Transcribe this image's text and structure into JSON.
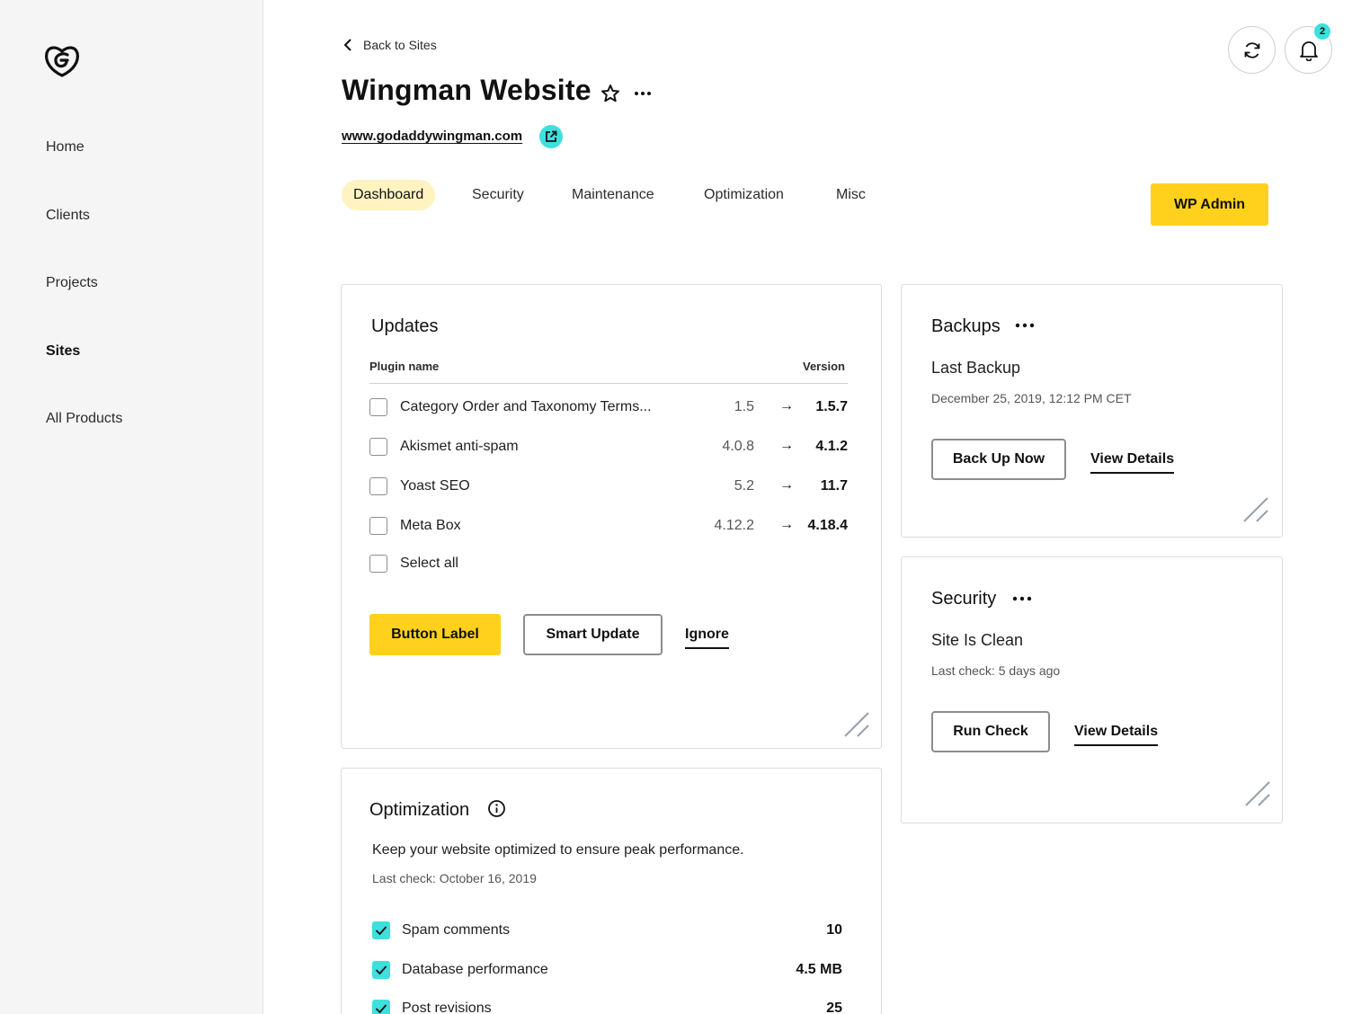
{
  "sidebar": {
    "logo_icon": "godaddy-logo",
    "items": [
      {
        "label": "Home",
        "active": false
      },
      {
        "label": "Clients",
        "active": false
      },
      {
        "label": "Projects",
        "active": false
      },
      {
        "label": "Sites",
        "active": true
      },
      {
        "label": "All Products",
        "active": false
      }
    ]
  },
  "header": {
    "back_label": "Back to Sites",
    "title": "Wingman Website",
    "url": "www.godaddywingman.com",
    "notification_count": "2"
  },
  "tabs": [
    {
      "label": "Dashboard",
      "active": true
    },
    {
      "label": "Security",
      "active": false
    },
    {
      "label": "Maintenance",
      "active": false
    },
    {
      "label": "Optimization",
      "active": false
    },
    {
      "label": "Misc",
      "active": false
    }
  ],
  "wp_admin_label": "WP Admin",
  "updates": {
    "title": "Updates",
    "col_plugin": "Plugin name",
    "col_version": "Version",
    "rows": [
      {
        "name": "Category Order and Taxonomy Terms...",
        "current": "1.5",
        "new": "1.5.7"
      },
      {
        "name": "Akismet anti-spam",
        "current": "4.0.8",
        "new": "4.1.2"
      },
      {
        "name": "Yoast SEO",
        "current": "5.2",
        "new": "11.7"
      },
      {
        "name": "Meta Box",
        "current": "4.12.2",
        "new": "4.18.4"
      }
    ],
    "arrow": "→",
    "select_all": "Select all",
    "primary_label": "Button Label",
    "smart_update_label": "Smart Update",
    "ignore_label": "Ignore"
  },
  "backups": {
    "title": "Backups",
    "subtitle": "Last Backup",
    "date": "December 25, 2019, 12:12 PM CET",
    "backup_now_label": "Back Up Now",
    "details_label": "View Details"
  },
  "security": {
    "title": "Security",
    "subtitle": "Site Is Clean",
    "last_check": "Last check: 5 days ago",
    "run_check_label": "Run Check",
    "details_label": "View Details"
  },
  "optimization": {
    "title": "Optimization",
    "description": "Keep your website optimized to ensure peak performance.",
    "last_check": "Last check: October 16, 2019",
    "items": [
      {
        "label": "Spam comments",
        "value": "10",
        "checked": true
      },
      {
        "label": "Database performance",
        "value": "4.5 MB",
        "checked": true
      },
      {
        "label": "Post revisions",
        "value": "25",
        "checked": true
      }
    ]
  },
  "colors": {
    "accent_yellow": "#ffd11d",
    "accent_teal": "#3ee0dd",
    "tab_active_bg": "#fff3c2"
  }
}
